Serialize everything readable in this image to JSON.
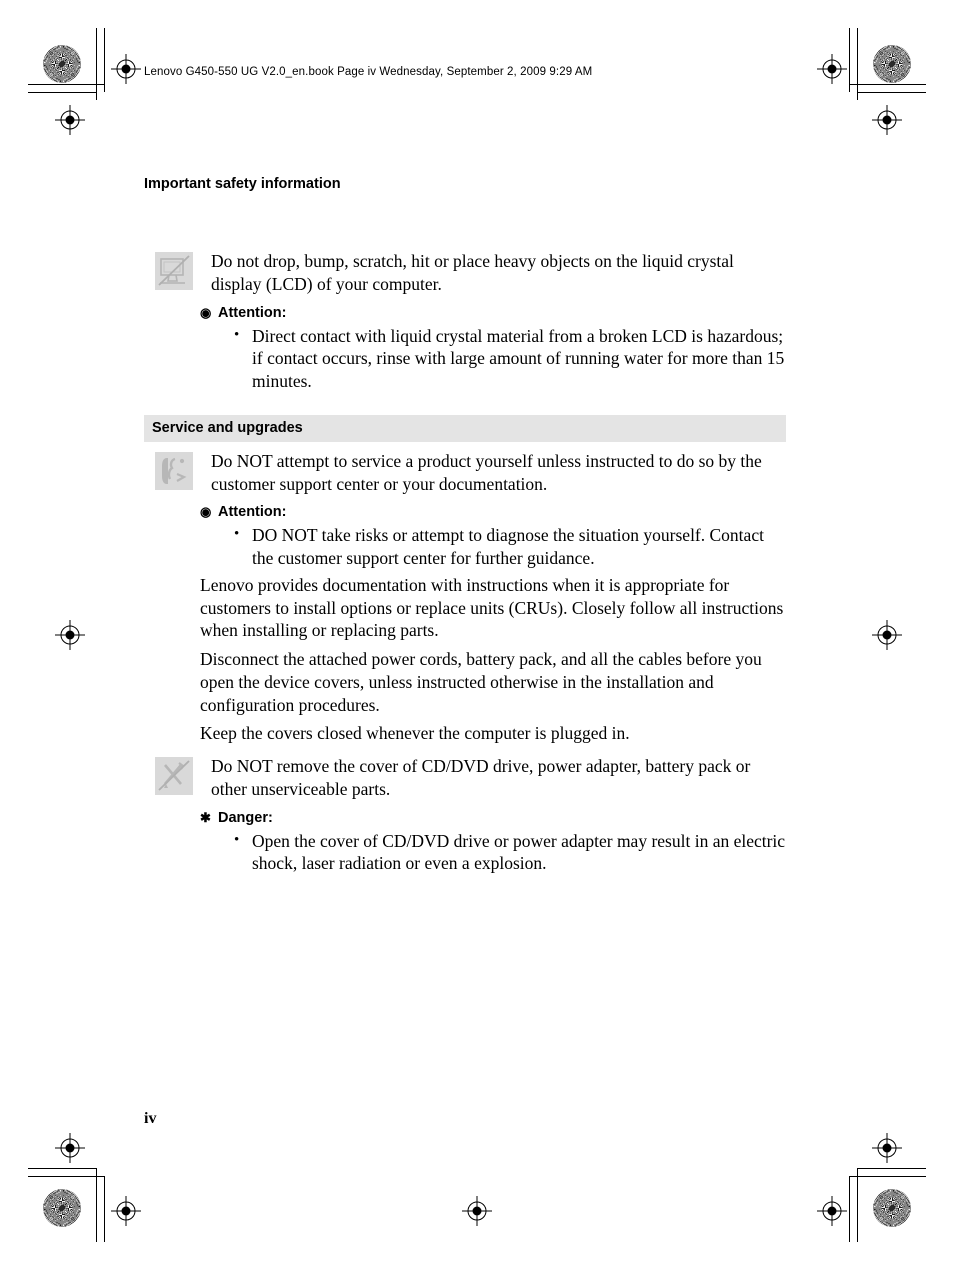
{
  "print_header": {
    "text": "Lenovo G450-550 UG V2.0_en.book  Page iv  Wednesday, September 2, 2009  9:29 AM"
  },
  "running_title": "Important safety information",
  "folio": "iv",
  "colors": {
    "banner_background": "#e4e4e4",
    "icon_background": "#d9d9d9",
    "text": "#000000"
  },
  "blocks": {
    "lcd": {
      "icon": "no-lcd-impact-icon",
      "text": "Do not drop, bump, scratch, hit or place heavy objects on the liquid crystal display (LCD) of your computer.",
      "warning": {
        "marker": "bullseye-marker",
        "marker_glyph": "◉",
        "label": "Attention:",
        "items": [
          "Direct contact with liquid crystal material from a broken LCD is hazardous; if contact occurs, rinse with large amount of running water for more than 15 minutes."
        ]
      }
    },
    "service": {
      "banner": "Service and upgrades",
      "icon": "support-telephone-icon",
      "text": "Do NOT attempt to service a product yourself unless instructed to do so by the customer support center or your documentation.",
      "warning": {
        "marker": "bullseye-marker",
        "marker_glyph": "◉",
        "label": "Attention:",
        "items": [
          "DO NOT take risks or attempt to diagnose the situation yourself. Contact the customer support center for further guidance."
        ]
      },
      "paragraphs": [
        "Lenovo provides documentation with instructions when it is appropriate for customers to install options or replace units (CRUs). Closely follow all instructions when installing or replacing parts.",
        "Disconnect the attached power cords, battery pack, and all the cables before you open the device covers, unless instructed otherwise in the installation and configuration procedures.",
        "Keep the covers closed whenever the computer is plugged in."
      ]
    },
    "cover": {
      "icon": "no-service-tools-icon",
      "text": "Do NOT remove the cover of CD/DVD drive, power adapter, battery pack or other unserviceable parts.",
      "warning": {
        "marker": "starburst-marker",
        "marker_glyph": "✱",
        "label": "Danger:",
        "items": [
          "Open the cover of CD/DVD drive or power adapter may result in an electric shock, laser radiation or even a explosion."
        ]
      }
    }
  }
}
